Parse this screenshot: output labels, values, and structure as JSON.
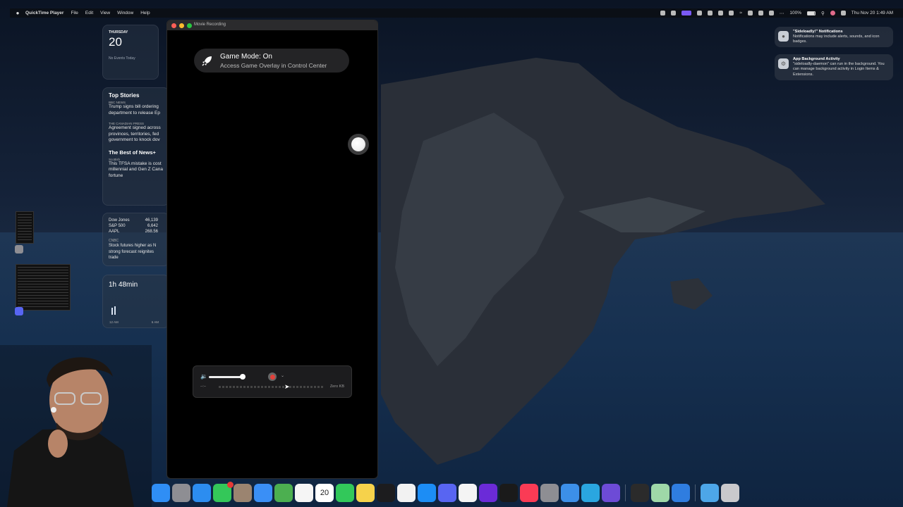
{
  "menubar": {
    "app_name": "QuickTime Player",
    "menus": [
      "File",
      "Edit",
      "View",
      "Window",
      "Help"
    ],
    "battery": "100%",
    "clock": "Thu Nov 20  1:49 AM"
  },
  "widgets": {
    "calendar": {
      "weekday": "THURSDAY",
      "day": "20",
      "events": "No Events Today"
    },
    "news": {
      "title": "Top Stories",
      "items": [
        {
          "source": "BBC NEWS",
          "headline": [
            "Trump signs bill ordering",
            "department to release Ep"
          ]
        },
        {
          "source": "THE CANADIAN PRESS",
          "headline": [
            "Agreement signed across",
            "provinces, territories, fed",
            "government to knock dov"
          ]
        }
      ],
      "section2": "The Best of News+",
      "section2_source": "Scottish",
      "section2_headline": [
        "This TFSA mistake is cost",
        "millennial and Gen Z Cana",
        "fortune"
      ]
    },
    "stocks": {
      "rows": [
        {
          "name": "Dow Jones",
          "value": "46,139"
        },
        {
          "name": "S&P 500",
          "value": "6,642"
        },
        {
          "name": "AAPL",
          "value": "268.56"
        }
      ],
      "source": "CNBC",
      "headline": [
        "Stock futures higher as N",
        "strong forecast reignites",
        "trade"
      ]
    },
    "screen_time": {
      "total": "1h 48min",
      "axis": [
        "12 AM",
        "6 AM"
      ]
    }
  },
  "movie_window": {
    "title": "Movie Recording",
    "game_mode_title": "Game Mode: On",
    "game_mode_subtitle": "Access Game Overlay in Control Center",
    "time": "--:--",
    "file_size": "Zero KB"
  },
  "notifications": [
    {
      "title": "\"Sideloadly!\" Notifications",
      "body": "Notifications may include alerts, sounds, and icon badges."
    },
    {
      "title": "App Background Activity",
      "body": "\"sideloadly-daemon\" can run in the background. You can manage background activity in Login Items & Extensions."
    }
  ],
  "dock": {
    "calendar_day": "20",
    "apps": [
      {
        "name": "finder-icon",
        "color": "#2f8ef5"
      },
      {
        "name": "launchpad-icon",
        "color": "#8e8e93"
      },
      {
        "name": "safari-icon",
        "color": "#2c8df0"
      },
      {
        "name": "messages-icon",
        "color": "#34c759"
      },
      {
        "name": "contacts-icon",
        "color": "#9b8470"
      },
      {
        "name": "mail-icon",
        "color": "#3a8ff6"
      },
      {
        "name": "maps-icon",
        "color": "#4caf50"
      },
      {
        "name": "photos-icon",
        "color": "#f5f5f5"
      },
      {
        "name": "calendar-icon",
        "color": "#ffffff"
      },
      {
        "name": "facetime-icon",
        "color": "#32c85a"
      },
      {
        "name": "notes-icon",
        "color": "#f6d24b"
      },
      {
        "name": "appletv-icon",
        "color": "#1c1c1e"
      },
      {
        "name": "reminders-icon",
        "color": "#f2f2f2"
      },
      {
        "name": "appstore-icon",
        "color": "#1c8df5"
      },
      {
        "name": "discord-icon",
        "color": "#5865f2"
      },
      {
        "name": "chrome-icon",
        "color": "#f4f4f4"
      },
      {
        "name": "arc-icon",
        "color": "#6b2bd8"
      },
      {
        "name": "cursor-app-icon",
        "color": "#1a1a1a"
      },
      {
        "name": "music-icon",
        "color": "#fa3b55"
      },
      {
        "name": "settings-icon",
        "color": "#8e8e93"
      },
      {
        "name": "weather-icon",
        "color": "#3c8fe8"
      },
      {
        "name": "klack-icon",
        "color": "#2aa6e0"
      },
      {
        "name": "imovie-icon",
        "color": "#6d4bd6"
      }
    ],
    "apps_right": [
      {
        "name": "activity-monitor-icon",
        "color": "#2b2b2b"
      },
      {
        "name": "sideloadly-icon",
        "color": "#9fd8a8"
      },
      {
        "name": "quicktime-icon",
        "color": "#2f7de0"
      }
    ],
    "folder_color": "#4da6e8",
    "trash_color": "#c9c9cc"
  }
}
